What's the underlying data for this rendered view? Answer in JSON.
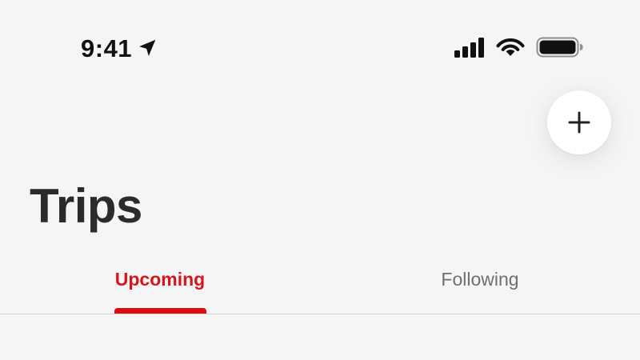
{
  "status_bar": {
    "time": "9:41",
    "icons": [
      "location-arrow-icon",
      "cellular-signal-icon",
      "wifi-icon",
      "battery-icon"
    ]
  },
  "header": {
    "title": "Trips",
    "add_button_icon": "plus-icon"
  },
  "tabs": [
    {
      "label": "Upcoming",
      "selected": true
    },
    {
      "label": "Following",
      "selected": false
    }
  ],
  "colors": {
    "background": "#f5f5f5",
    "accent": "#d80f12",
    "title": "#2b2b2b",
    "inactive_tab": "#6f6f6f",
    "divider": "#d6d6d6"
  }
}
